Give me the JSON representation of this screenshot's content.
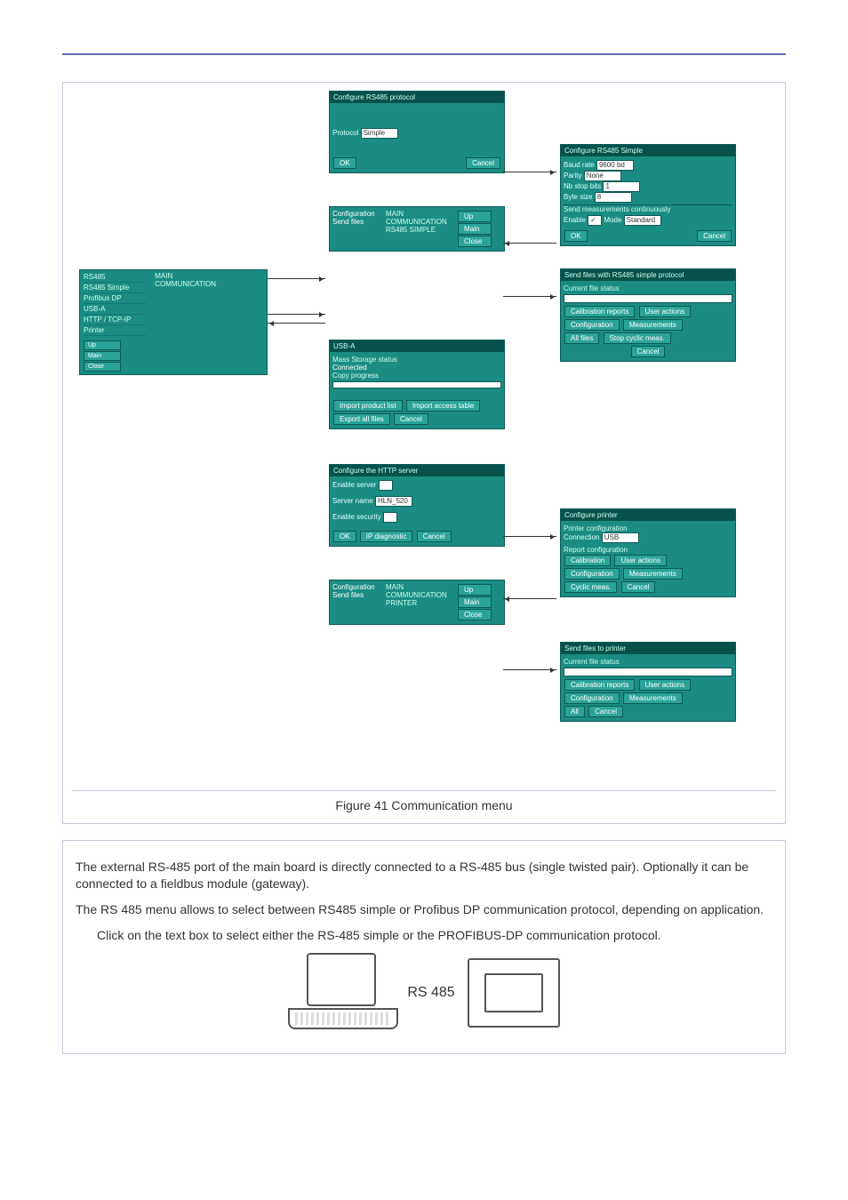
{
  "figure": {
    "caption": "Figure 41  Communication menu",
    "protocol_dialog": {
      "title": "Configure RS485 protocol",
      "label": "Protocol",
      "value": "Simple",
      "ok": "OK",
      "cancel": "Cancel"
    },
    "simple_dialog": {
      "title": "Configure RS485 Simple",
      "baud_label": "Baud rate",
      "baud_value": "9600 bd",
      "parity_label": "Parity",
      "parity_value": "None",
      "stopbits_label": "Nb stop bits",
      "stopbits_value": "1",
      "bytesize_label": "Byte size",
      "bytesize_value": "8",
      "send_group": "Send measurements continuously",
      "enable_label": "Enable",
      "mode_label": "Mode",
      "mode_value": "Standard",
      "ok": "OK",
      "cancel": "Cancel"
    },
    "sendfiles_simple": {
      "title": "Send files with RS485 simple protocol",
      "status_label": "Current file status",
      "btn_cal": "Calibration reports",
      "btn_user": "User actions",
      "btn_conf": "Configuration",
      "btn_meas": "Measurements",
      "btn_all": "All files",
      "btn_stop": "Stop cyclic meas.",
      "cancel": "Cancel"
    },
    "nav_panel": {
      "title": "Configuration\nSend files",
      "path": "MAIN\nCOMMUNICATION\nRS485 SIMPLE",
      "up": "Up",
      "main": "Main",
      "close": "Close"
    },
    "sidebar": {
      "items": [
        "RS485",
        "RS485 Simple",
        "Profibus DP",
        "USB-A",
        "HTTP / TCP-IP",
        "Printer"
      ],
      "path_col": [
        "MAIN",
        "COMMUNICATION"
      ],
      "right": [
        "Up",
        "Main",
        "Close"
      ]
    },
    "usb_dialog": {
      "title": "USB-A",
      "group": "Mass Storage status",
      "status": "Connected",
      "copy": "Copy progress",
      "b1": "Import product list",
      "b2": "Import access table",
      "b3": "Export all files",
      "cancel": "Cancel"
    },
    "http_dialog": {
      "title": "Configure the HTTP server",
      "enable_label": "Enable server",
      "name_label": "Server name",
      "name_value": "HLN_520",
      "security_label": "Enable security",
      "ok": "OK",
      "diag": "IP diagnostic",
      "cancel": "Cancel"
    },
    "nav_panel2": {
      "title": "Configuration\nSend files",
      "path": "MAIN\nCOMMUNICATION\nPRINTER",
      "up": "Up",
      "main": "Main",
      "close": "Close"
    },
    "printer_dialog": {
      "title": "Configure printer",
      "group1": "Printer configuration",
      "conn_label": "Connection",
      "conn_value": "USB",
      "group2": "Report configuration",
      "b1": "Calibration",
      "b2": "User actions",
      "b3": "Configuration",
      "b4": "Measurements",
      "b5": "Cyclic meas.",
      "cancel": "Cancel"
    },
    "sendfiles_printer": {
      "title": "Send files to printer",
      "status_label": "Current file status",
      "b1": "Calibration reports",
      "b2": "User actions",
      "b3": "Configuration",
      "b4": "Measurements",
      "b5": "All",
      "cancel": "Cancel"
    }
  },
  "description": {
    "p1": "The external RS-485 port of the main board is directly connected to a RS-485 bus (single twisted pair). Optionally it can be connected to a fieldbus module (gateway).",
    "p2": "The RS 485 menu allows to select between RS485 simple or Profibus DP communication protocol, depending on application.",
    "p3": "Click on the text box to select either the RS-485 simple or the PROFIBUS-DP communication protocol.",
    "rs_label": "RS 485"
  }
}
